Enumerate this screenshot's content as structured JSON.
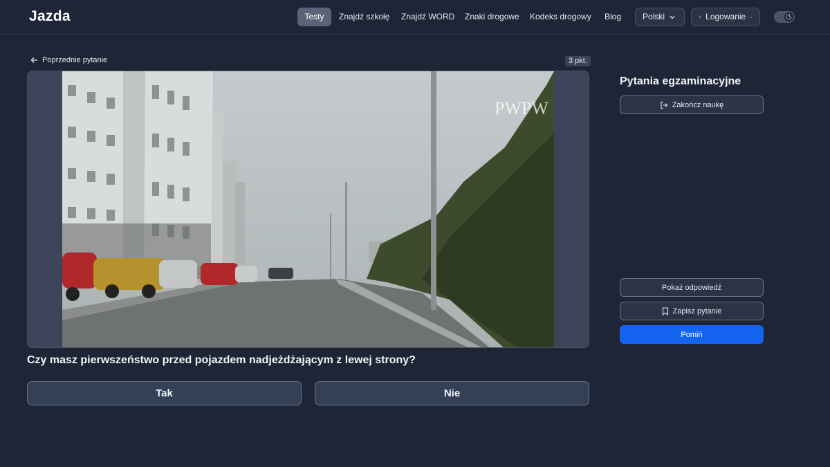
{
  "brand": {
    "logo": "Jazda"
  },
  "nav": {
    "items": [
      "Testy",
      "Znajdź szkołę",
      "Znajdź WORD",
      "Znaki drogowe",
      "Kodeks drogowy",
      "Blog"
    ],
    "active": "Testy",
    "language": "Polski",
    "login": "Logowanie"
  },
  "question": {
    "back_label": "Poprzednie pytanie",
    "points": "3 pkt.",
    "text": "Czy masz pierwszeństwo przed pojazdem nadjeżdżającym z lewej strony?",
    "answers": [
      "Tak",
      "Nie"
    ],
    "image_watermark": "PWPW"
  },
  "sidebar": {
    "title": "Pytania egzaminacyjne",
    "finish_label": "Zakończ naukę",
    "show_answer_label": "Pokaż odpowiedź",
    "save_label": "Zapisz pytanie",
    "skip_label": "Pomiń"
  },
  "colors": {
    "background": "#1e2536",
    "accent": "#1464f0",
    "active_nav": "#5a6478"
  }
}
